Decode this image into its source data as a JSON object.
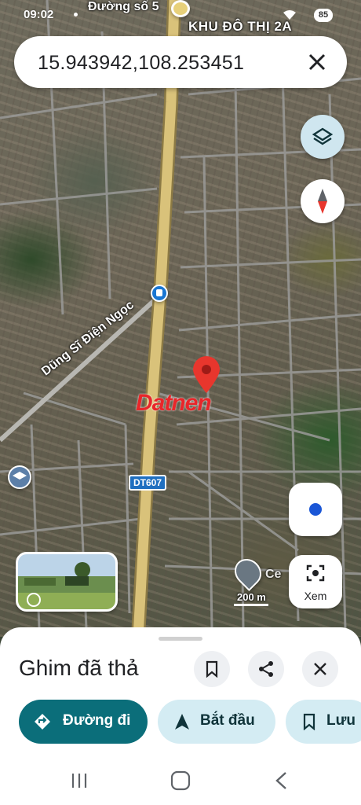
{
  "status_bar": {
    "time": "09:02",
    "battery": "85"
  },
  "map": {
    "labels": {
      "street_top": "Đường số 5",
      "district": "KHU ĐÔ THỊ 2A",
      "road_diagonal": "Dũng Sĩ Điện Ngọc",
      "route_badge": "DT607",
      "scale": "200 m",
      "place_partial": "Ce"
    },
    "watermark": "Datnen",
    "colors": {
      "pin": "#e8362d",
      "highway": "#d9c27a",
      "accent": "#0b6e7a"
    }
  },
  "search": {
    "query": "15.943942,108.253451",
    "close_icon": "close-icon"
  },
  "controls": {
    "layers_icon": "layers-icon",
    "compass_icon": "compass-icon",
    "my_location_icon": "my-location-icon",
    "lens_label": "Xem"
  },
  "sheet": {
    "title": "Ghim đã thả",
    "actions": {
      "directions": "Đường đi",
      "start": "Bắt đầu",
      "save": "Lưu"
    },
    "icons": [
      "bookmark-icon",
      "share-icon",
      "close-icon"
    ]
  },
  "nav_bar": {
    "icons": [
      "recents-icon",
      "home-icon",
      "back-icon"
    ]
  }
}
